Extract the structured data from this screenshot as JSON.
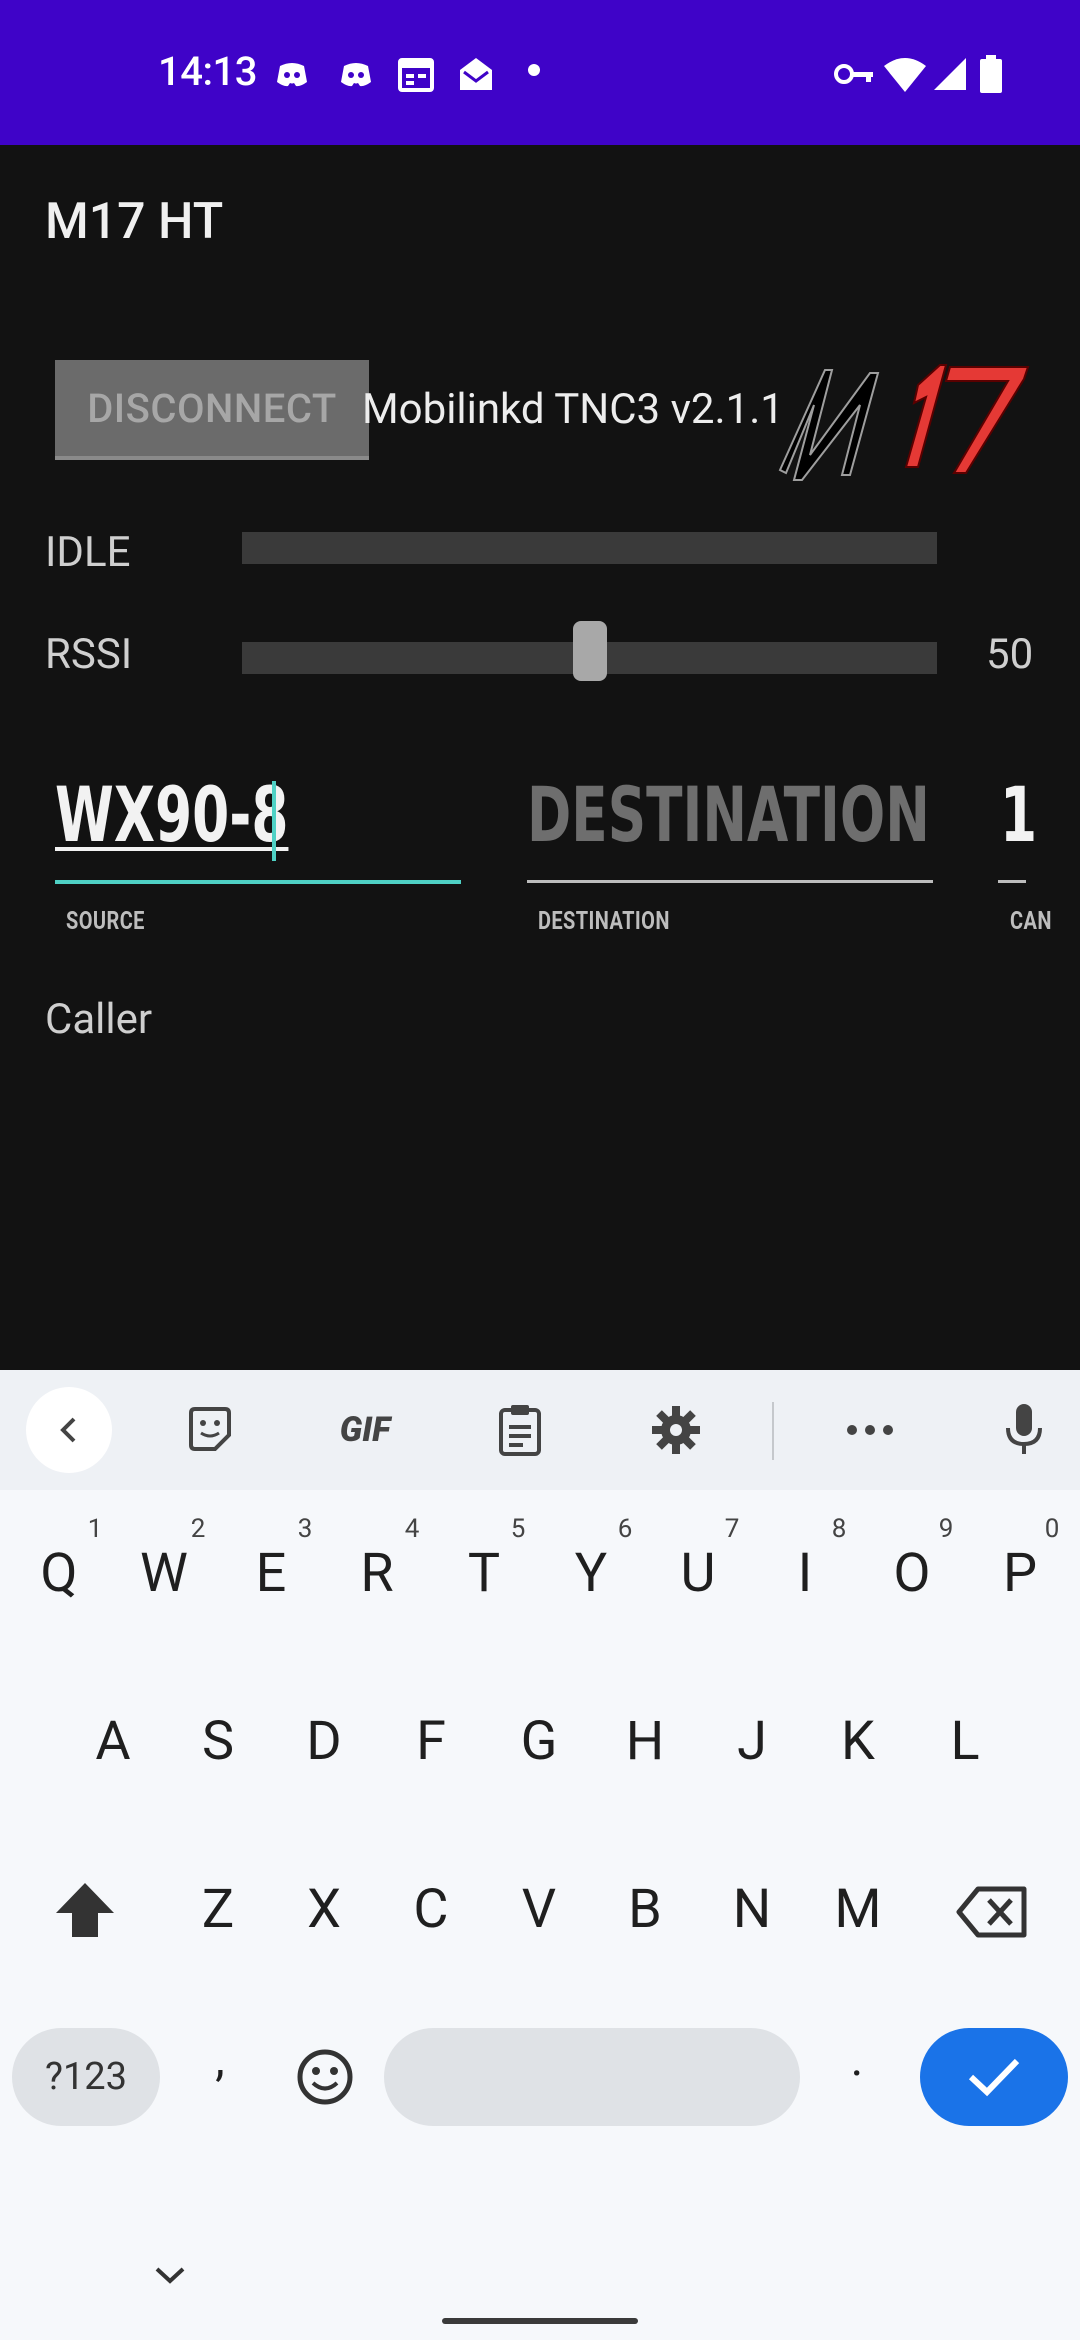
{
  "status_bar": {
    "time": "14:13"
  },
  "app": {
    "title": "M17 HT",
    "disconnect_label": "DISCONNECT",
    "device_name": "Mobilinkd TNC3 v2.1.1",
    "logo_text_left": "M",
    "logo_text_right": "17",
    "idle_label": "IDLE",
    "rssi_label": "RSSI",
    "rssi_value": "50",
    "rssi_level": 0.5,
    "source_value": "WX90-8",
    "source_label": "SOURCE",
    "destination_placeholder": "DESTINATION",
    "destination_label": "DESTINATION",
    "can_value": "1",
    "can_label": "CAN",
    "caller_label": "Caller"
  },
  "keyboard": {
    "toolbar": {
      "gif_label": "GIF"
    },
    "row1": [
      "Q",
      "W",
      "E",
      "R",
      "T",
      "Y",
      "U",
      "I",
      "O",
      "P"
    ],
    "row1_hints": [
      "1",
      "2",
      "3",
      "4",
      "5",
      "6",
      "7",
      "8",
      "9",
      "0"
    ],
    "row2": [
      "A",
      "S",
      "D",
      "F",
      "G",
      "H",
      "J",
      "K",
      "L"
    ],
    "row3": [
      "Z",
      "X",
      "C",
      "V",
      "B",
      "N",
      "M"
    ],
    "symbols_label": "?123",
    "comma": ",",
    "period": "."
  },
  "colors": {
    "status_bar": "#3f03c8",
    "accent": "#4fd1c5",
    "logo_red": "#e53935",
    "enter_blue": "#1a73e8"
  }
}
